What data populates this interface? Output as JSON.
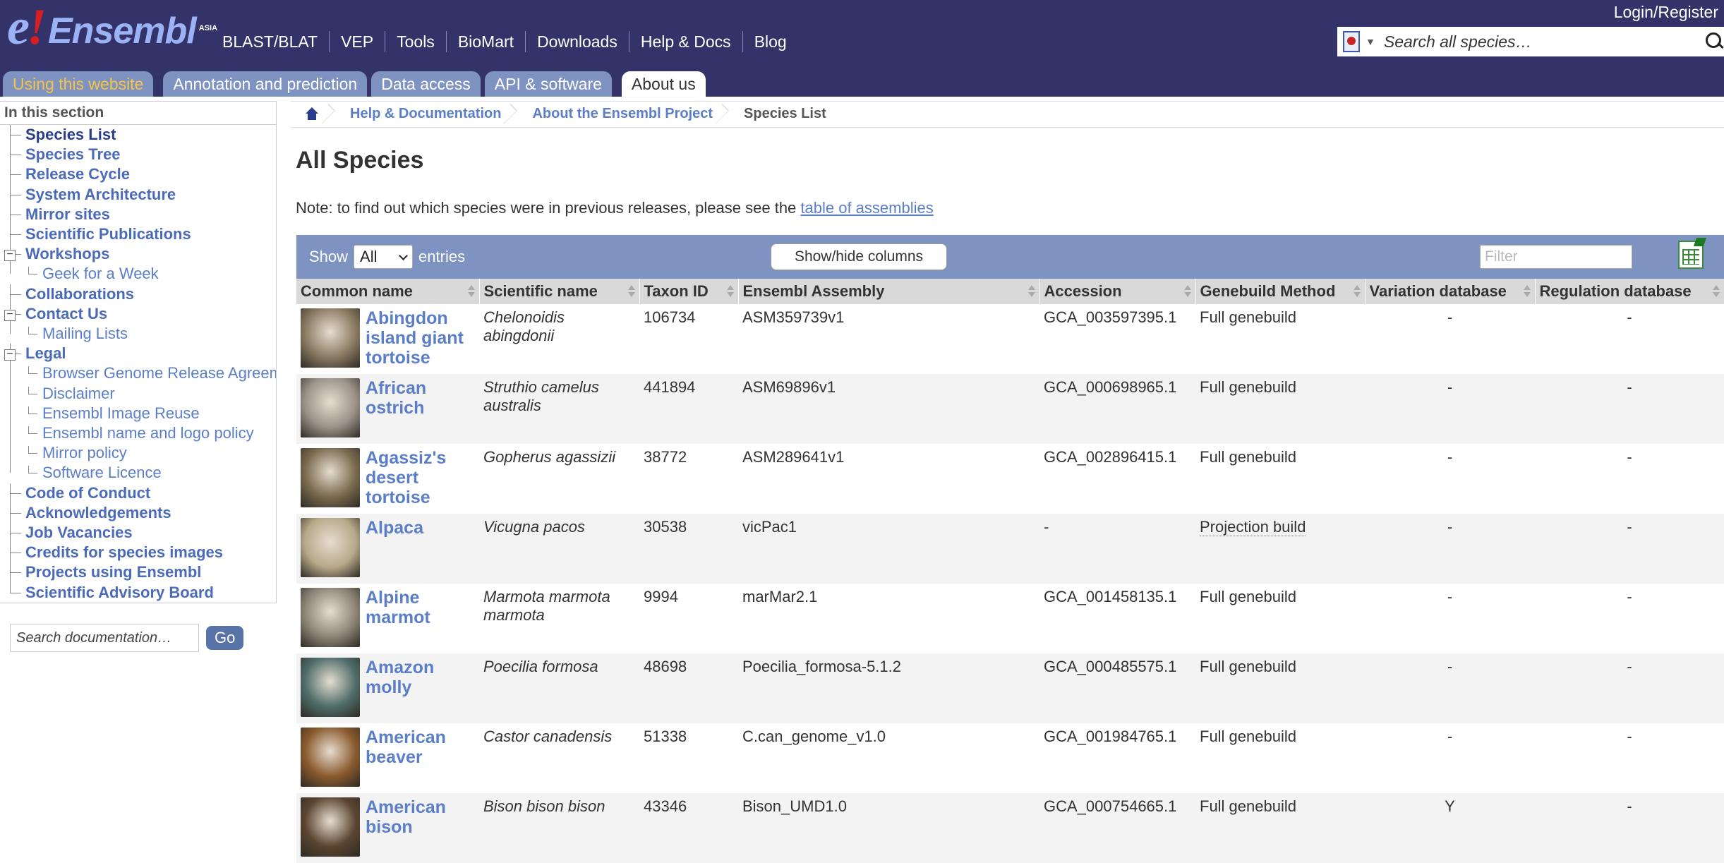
{
  "brand": {
    "logo_e": "e",
    "logo_bang": "!",
    "logo_word": "Ensembl",
    "logo_sub": "ASIA"
  },
  "login_label": "Login/Register",
  "topnav": [
    "BLAST/BLAT",
    "VEP",
    "Tools",
    "BioMart",
    "Downloads",
    "Help & Docs",
    "Blog"
  ],
  "search": {
    "placeholder": "Search all species…"
  },
  "tabs": [
    "Using this website",
    "Annotation and prediction",
    "Data access",
    "API & software",
    "About us"
  ],
  "sidebar": {
    "heading": "In this section",
    "items": [
      {
        "label": "Species List",
        "level": 1
      },
      {
        "label": "Species Tree",
        "level": 1
      },
      {
        "label": "Release Cycle",
        "level": 1
      },
      {
        "label": "System Architecture",
        "level": 1
      },
      {
        "label": "Mirror sites",
        "level": 1
      },
      {
        "label": "Scientific Publications",
        "level": 1
      },
      {
        "label": "Workshops",
        "level": 1
      },
      {
        "label": "Geek for a Week",
        "level": 2
      },
      {
        "label": "Collaborations",
        "level": 1
      },
      {
        "label": "Contact Us",
        "level": 1
      },
      {
        "label": "Mailing Lists",
        "level": 2
      },
      {
        "label": "Legal",
        "level": 1
      },
      {
        "label": "Browser Genome Release Agreement",
        "level": 2
      },
      {
        "label": "Disclaimer",
        "level": 2
      },
      {
        "label": "Ensembl Image Reuse",
        "level": 2
      },
      {
        "label": "Ensembl name and logo policy",
        "level": 2
      },
      {
        "label": "Mirror policy",
        "level": 2
      },
      {
        "label": "Software Licence",
        "level": 2
      },
      {
        "label": "Code of Conduct",
        "level": 1
      },
      {
        "label": "Acknowledgements",
        "level": 1
      },
      {
        "label": "Job Vacancies",
        "level": 1
      },
      {
        "label": "Credits for species images",
        "level": 1
      },
      {
        "label": "Projects using Ensembl",
        "level": 1
      },
      {
        "label": "Scientific Advisory Board",
        "level": 1
      }
    ],
    "doc_search_placeholder": "Search documentation…",
    "go_label": "Go"
  },
  "breadcrumb": [
    "Help & Documentation",
    "About the Ensembl Project",
    "Species List"
  ],
  "page_title": "All Species",
  "note": {
    "text": "Note: to find out which species were in previous releases, please see the ",
    "link": "table of assemblies"
  },
  "controls": {
    "show": "Show",
    "show_value": "All",
    "entries": "entries",
    "toggle_columns": "Show/hide columns",
    "filter_placeholder": "Filter"
  },
  "columns": [
    "Common name",
    "Scientific name",
    "Taxon ID",
    "Ensembl Assembly",
    "Accession",
    "Genebuild Method",
    "Variation database",
    "Regulation database"
  ],
  "rows": [
    {
      "common": "Abingdon island giant tortoise",
      "scientific": "Chelonoidis abingdonii",
      "taxon": "106734",
      "assembly": "ASM359739v1",
      "accession": "GCA_003597395.1",
      "method": "Full genebuild",
      "variation": "-",
      "regulation": "-",
      "color": "#8a7a62"
    },
    {
      "common": "African ostrich",
      "scientific": "Struthio camelus australis",
      "taxon": "441894",
      "assembly": "ASM69896v1",
      "accession": "GCA_000698965.1",
      "method": "Full genebuild",
      "variation": "-",
      "regulation": "-",
      "color": "#9a9288"
    },
    {
      "common": "Agassiz's desert tortoise",
      "scientific": "Gopherus agassizii",
      "taxon": "38772",
      "assembly": "ASM289641v1",
      "accession": "GCA_002896415.1",
      "method": "Full genebuild",
      "variation": "-",
      "regulation": "-",
      "color": "#7a6a4e"
    },
    {
      "common": "Alpaca",
      "scientific": "Vicugna pacos",
      "taxon": "30538",
      "assembly": "vicPac1",
      "accession": "-",
      "method": "Projection build",
      "variation": "-",
      "regulation": "-",
      "color": "#b8a98a"
    },
    {
      "common": "Alpine marmot",
      "scientific": "Marmota marmota marmota",
      "taxon": "9994",
      "assembly": "marMar2.1",
      "accession": "GCA_001458135.1",
      "method": "Full genebuild",
      "variation": "-",
      "regulation": "-",
      "color": "#8d8577"
    },
    {
      "common": "Amazon molly",
      "scientific": "Poecilia formosa",
      "taxon": "48698",
      "assembly": "Poecilia_formosa-5.1.2",
      "accession": "GCA_000485575.1",
      "method": "Full genebuild",
      "variation": "-",
      "regulation": "-",
      "color": "#4f6d6a"
    },
    {
      "common": "American beaver",
      "scientific": "Castor canadensis",
      "taxon": "51338",
      "assembly": "C.can_genome_v1.0",
      "accession": "GCA_001984765.1",
      "method": "Full genebuild",
      "variation": "-",
      "regulation": "-",
      "color": "#8a5a2e"
    },
    {
      "common": "American bison",
      "scientific": "Bison bison bison",
      "taxon": "43346",
      "assembly": "Bison_UMD1.0",
      "accession": "GCA_000754665.1",
      "method": "Full genebuild",
      "variation": "Y",
      "regulation": "-",
      "color": "#5a4530"
    }
  ]
}
